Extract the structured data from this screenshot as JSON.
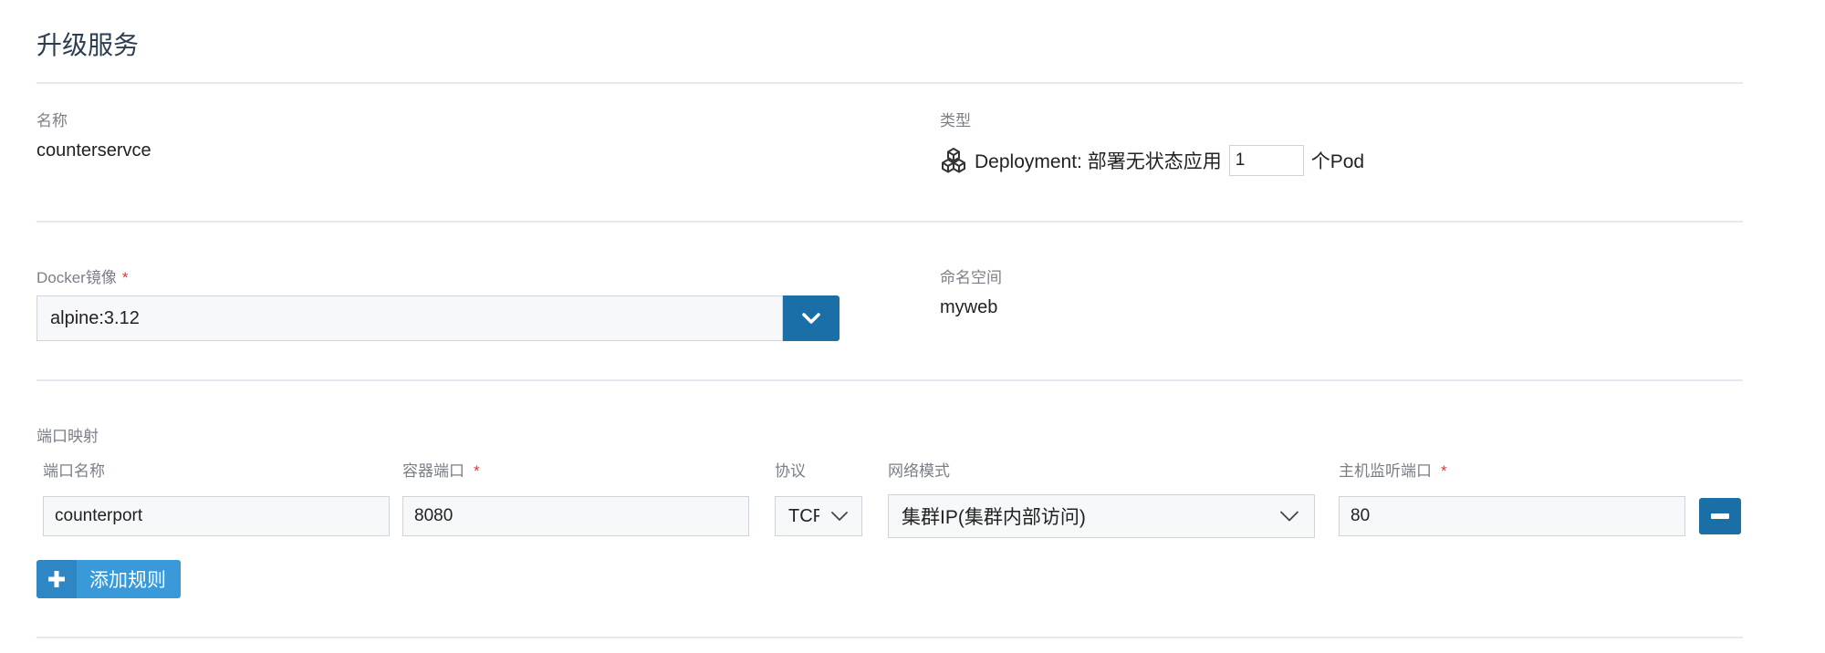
{
  "page": {
    "title": "升级服务"
  },
  "basic": {
    "name_label": "名称",
    "name_value": "counterservce",
    "type_label": "类型",
    "type_text": "Deployment: 部署无状态应用",
    "replicas": "1",
    "replicas_unit": "个Pod",
    "type_icon": "cube-cluster-icon"
  },
  "image": {
    "label": "Docker镜像",
    "required_mark": "*",
    "value": "alpine:3.12",
    "dropdown_icon": "chevron-down-icon"
  },
  "namespace": {
    "label": "命名空间",
    "value": "myweb"
  },
  "ports": {
    "section_label": "端口映射",
    "columns": {
      "name": "端口名称",
      "container_port": "容器端口",
      "protocol": "协议",
      "network_mode": "网络模式",
      "host_port": "主机监听端口"
    },
    "required_mark": "*",
    "rows": [
      {
        "name": "counterport",
        "container_port": "8080",
        "protocol": "TCP",
        "network_mode": "集群IP(集群内部访问)",
        "host_port": "80"
      }
    ],
    "remove_icon": "minus-icon",
    "add_button": {
      "icon": "plus-icon",
      "label": "添加规则"
    }
  },
  "colors": {
    "primary": "#1a6fa6",
    "add_button": "#3a9ad9",
    "add_button_icon_bg": "#2f86c4",
    "required": "#d9383a",
    "divider": "#e6e9ee"
  }
}
